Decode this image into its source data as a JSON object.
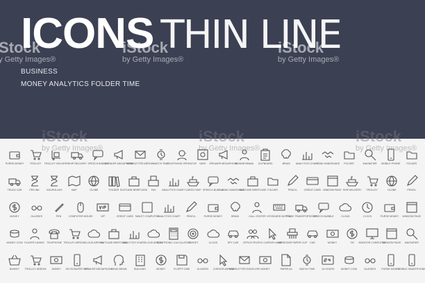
{
  "header": {
    "title_bold": "ICONS",
    "title_thin": "THIN LINE",
    "subtitle_1": "BUSINESS",
    "subtitle_2": "MONEY  ANALYTICS  FOLDER  TIME",
    "background": "#3c4053"
  },
  "watermark": {
    "logo": "iStock",
    "credit": "by Getty Images®"
  },
  "icon_rows": [
    [
      {
        "icon": "wallet",
        "label": "PURSE MONEY"
      },
      {
        "icon": "trolley",
        "label": "TROLLEY"
      },
      {
        "icon": "trolley-box",
        "label": "TROLLEY DELIVERY"
      },
      {
        "icon": "truck",
        "label": "SHIP DELIVERY"
      },
      {
        "icon": "speech",
        "label": "SPEECH BUBBLE"
      },
      {
        "icon": "megaphone",
        "label": "SPEAKER MEGAPHONE"
      },
      {
        "icon": "envelope",
        "label": "NEWSLETTER ARROW"
      },
      {
        "icon": "watch",
        "label": "WATCH TIME"
      },
      {
        "icon": "operator",
        "label": "TELEPHONE OPERATOR"
      },
      {
        "icon": "safe",
        "label": "SAFE"
      },
      {
        "icon": "megaphone",
        "label": "SPEAKER MEGAPHONE"
      },
      {
        "icon": "person",
        "label": "BUSINESSMAN"
      },
      {
        "icon": "clipboard",
        "label": "CLIPBOARD"
      },
      {
        "icon": "brain",
        "label": "BRAIN"
      },
      {
        "icon": "chart",
        "label": "ANALYTICS CHART"
      },
      {
        "icon": "handshake",
        "label": "HAND HANDSHAKE"
      },
      {
        "icon": "folder",
        "label": "FOLDER"
      },
      {
        "icon": "magnifier",
        "label": "MAGNIFIER"
      },
      {
        "icon": "phone",
        "label": "MOBILE PHONE"
      },
      {
        "icon": "folder",
        "label": "FOLDER"
      }
    ],
    [
      {
        "icon": "truck",
        "label": "TRUCK CAR"
      },
      {
        "icon": "hourglass",
        "label": "PEN INK"
      },
      {
        "icon": "hourglass",
        "label": "HOURGLASS"
      },
      {
        "icon": "map",
        "label": "MAP"
      },
      {
        "icon": "globe",
        "label": "GLOBE"
      },
      {
        "icon": "books",
        "label": "FOLDER"
      },
      {
        "icon": "briefcase",
        "label": "SUITCASE BRIEFCASE"
      },
      {
        "icon": "fax",
        "label": "FAX"
      },
      {
        "icon": "chart",
        "label": "ANALYTICS CHART"
      },
      {
        "icon": "ship",
        "label": "CARGO SHIP"
      },
      {
        "icon": "speech",
        "label": "SPEECH BUBBLE"
      },
      {
        "icon": "handshake",
        "label": "HAND HANDSHAKE"
      },
      {
        "icon": "briefcase",
        "label": "SUITCASE BRIEFCASE"
      },
      {
        "icon": "folder",
        "label": "FOLDER"
      },
      {
        "icon": "pencil",
        "label": "PENCIL"
      },
      {
        "icon": "card",
        "label": "CREDIT CARD"
      },
      {
        "icon": "window",
        "label": "WINDOW PAGE"
      },
      {
        "icon": "ship",
        "label": "SHIP DELIVERY"
      },
      {
        "icon": "trolley",
        "label": "TROLLEY"
      },
      {
        "icon": "globe",
        "label": "GLOBE"
      },
      {
        "icon": "pencil",
        "label": "PENCIL"
      }
    ],
    [
      {
        "icon": "dollar",
        "label": "MONEY"
      },
      {
        "icon": "glasses",
        "label": "GLASSES"
      },
      {
        "icon": "pen",
        "label": "PEN"
      },
      {
        "icon": "mouse",
        "label": "COMPUTER MOUSE"
      },
      {
        "icon": "vip",
        "label": "VIP"
      },
      {
        "icon": "card",
        "label": "CREDIT CARD"
      },
      {
        "icon": "tablet",
        "label": "TABLET COMPUTER"
      },
      {
        "icon": "chart",
        "label": "ANALYTICS CHART"
      },
      {
        "icon": "pencil",
        "label": "PENCIL"
      },
      {
        "icon": "wallet",
        "label": "PURSE MONEY"
      },
      {
        "icon": "brain",
        "label": "BRAIN"
      },
      {
        "icon": "person",
        "label": "CALL CENTER"
      },
      {
        "icon": "keyboard",
        "label": "KEYBOARD BUTTON"
      },
      {
        "icon": "truck",
        "label": "TRUCK TRANSPORTATION"
      },
      {
        "icon": "speech",
        "label": "SPEECH BUBBLE"
      },
      {
        "icon": "cloud",
        "label": "CLOUD"
      },
      {
        "icon": "clock",
        "label": "CLOCK"
      },
      {
        "icon": "wallet",
        "label": "PURSE MONEY"
      },
      {
        "icon": "window",
        "label": "WINDOW PAGE"
      }
    ],
    [
      {
        "icon": "coins",
        "label": "MONEY COIN"
      },
      {
        "icon": "person",
        "label": "PLAYER CASINO"
      },
      {
        "icon": "telephone",
        "label": "TELEPHONE"
      },
      {
        "icon": "trolley",
        "label": "TROLLEY ARROW"
      },
      {
        "icon": "cloud",
        "label": "CLOUD ARROW"
      },
      {
        "icon": "briefcase",
        "label": "SUITCASE BRIEFCASE"
      },
      {
        "icon": "chart",
        "label": "ANALYTICS CHART"
      },
      {
        "icon": "cloud",
        "label": "CLOUD ARROW"
      },
      {
        "icon": "calculator",
        "label": "ELECTRONIC CALCULATOR"
      },
      {
        "icon": "target",
        "label": "TARGET"
      },
      {
        "icon": "cloud",
        "label": "CLOUD"
      },
      {
        "icon": "car",
        "label": "SPY CAR"
      },
      {
        "icon": "people",
        "label": "OFFICE PEOPLE"
      },
      {
        "icon": "cursor",
        "label": "CURSOR HAND"
      },
      {
        "icon": "shredder",
        "label": "SHREDDER PAPER CLIP"
      },
      {
        "icon": "car",
        "label": "CAR"
      },
      {
        "icon": "money",
        "label": "MONEY"
      },
      {
        "icon": "dollar",
        "label": "TIE"
      },
      {
        "icon": "monitor",
        "label": "MONITOR COMPUTER"
      },
      {
        "icon": "window",
        "label": "WINDOW PAGE"
      },
      {
        "icon": "magnifier",
        "label": "MAGNIFIER"
      }
    ],
    [
      {
        "icon": "basket",
        "label": "BASKET"
      },
      {
        "icon": "trolley",
        "label": "TROLLEY ARROW"
      },
      {
        "icon": "money",
        "label": "MONEY"
      },
      {
        "icon": "phone",
        "label": "SKYSCRAPER CITY"
      },
      {
        "icon": "megaphone",
        "label": "SPEAKER MEGAPHONE"
      },
      {
        "icon": "head",
        "label": "HEAD BRAIN"
      },
      {
        "icon": "building",
        "label": "BUILDING"
      },
      {
        "icon": "dollar",
        "label": "MONEY"
      },
      {
        "icon": "floppy",
        "label": "FLOPPY DISK"
      },
      {
        "icon": "glasses",
        "label": "GLASSES"
      },
      {
        "icon": "cursor",
        "label": "CURSOR ARROW"
      },
      {
        "icon": "envelope",
        "label": "NEWSLETTER ENVELOPE"
      },
      {
        "icon": "money",
        "label": "MONEY"
      },
      {
        "icon": "paper",
        "label": "PAPER A4"
      },
      {
        "icon": "watch",
        "label": "WATCH TIME"
      },
      {
        "icon": "h24",
        "label": "24 HOURS"
      },
      {
        "icon": "coins",
        "label": "MONEY COIN"
      },
      {
        "icon": "glasses",
        "label": "GLASSES"
      },
      {
        "icon": "phone",
        "label": "PURSE MONEY"
      },
      {
        "icon": "phone",
        "label": "MOBILE SMARTPHONE"
      }
    ]
  ]
}
